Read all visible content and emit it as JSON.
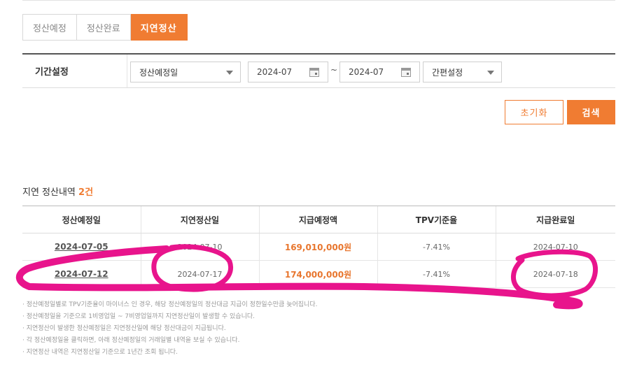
{
  "tabs": [
    {
      "label": "정산예정",
      "active": false
    },
    {
      "label": "정산완료",
      "active": false
    },
    {
      "label": "지연정산",
      "active": true
    }
  ],
  "filter": {
    "label": "기간설정",
    "date_type": "정산예정일",
    "start": "2024-07",
    "separator": "~",
    "end": "2024-07",
    "quick": "간편설정"
  },
  "buttons": {
    "reset": "초기화",
    "search": "검색"
  },
  "section": {
    "title": "지연 정산내역",
    "count": "2건"
  },
  "table": {
    "headers": [
      "정산예정일",
      "지연정산일",
      "지급예정액",
      "TPV기준율",
      "지급완료일"
    ],
    "rows": [
      [
        "2024-07-05",
        "2024-07-10",
        "169,010,000원",
        "-7.41%",
        "2024-07-10"
      ],
      [
        "2024-07-12",
        "2024-07-17",
        "174,000,000원",
        "-7.41%",
        "2024-07-18"
      ]
    ]
  },
  "notes": [
    "정산예정일별로 TPV기준율이 마이너스 인 경우, 해당 정산예정일의 정산대금 지급이 정한일수만큼 늦어집니다.",
    "정산예정일을 기준으로 1비영업일 ~ 7비영업일까지 지연정산일이 발생할 수 있습니다.",
    "지연정산이 발생한 정산예정일은 지연정산일에 해당 정산대금이 지급됩니다.",
    "각 정산예정일을 클릭하면, 아래 정산예정일의 거래일별 내역을 보실 수 있습니다.",
    "지연정산 내역은 지연정산일 기준으로 1년간 조회 됩니다."
  ],
  "colors": {
    "accent": "#f07c32",
    "markup": "#e8148c"
  }
}
